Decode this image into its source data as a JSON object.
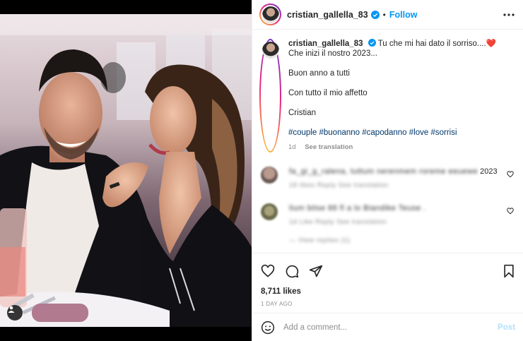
{
  "header": {
    "username": "cristian_gallella_83",
    "separator": "•",
    "follow_label": "Follow"
  },
  "caption": {
    "username": "cristian_gallella_83",
    "line1": "Tu che mi hai dato il sorriso....❤️",
    "line2": "Che inizi il nostro 2023...",
    "line3": "Buon anno a tutti",
    "line4": "Con tutto il mio affetto",
    "line5": "Cristian",
    "hashtags": [
      "#couple",
      "#buonanno",
      "#capodanno",
      "#love",
      "#sorrisi"
    ],
    "age": "1d",
    "see_translation": "See translation"
  },
  "comments": [
    {
      "text_blurred": "fa_gi_g_ralena, tuttum nerenmem roreme eeuewe",
      "text_clear": "2023",
      "meta_blurred": "18 tikes  Reply  See translation"
    },
    {
      "text_blurred": "lium bitse 88 fl a lo Biandike Teuse .",
      "meta_blurred": "1d  Like  Reply  See translation",
      "replies_blurred": "—  View replies (1)"
    }
  ],
  "likes": "8,711 likes",
  "date": "1 DAY AGO",
  "add_comment": {
    "placeholder": "Add a comment...",
    "post_label": "Post"
  },
  "colors": {
    "accent": "#0095f6",
    "post_disabled": "#b2dffc",
    "hashtag": "#00376b",
    "muted": "#8e8e8e"
  }
}
